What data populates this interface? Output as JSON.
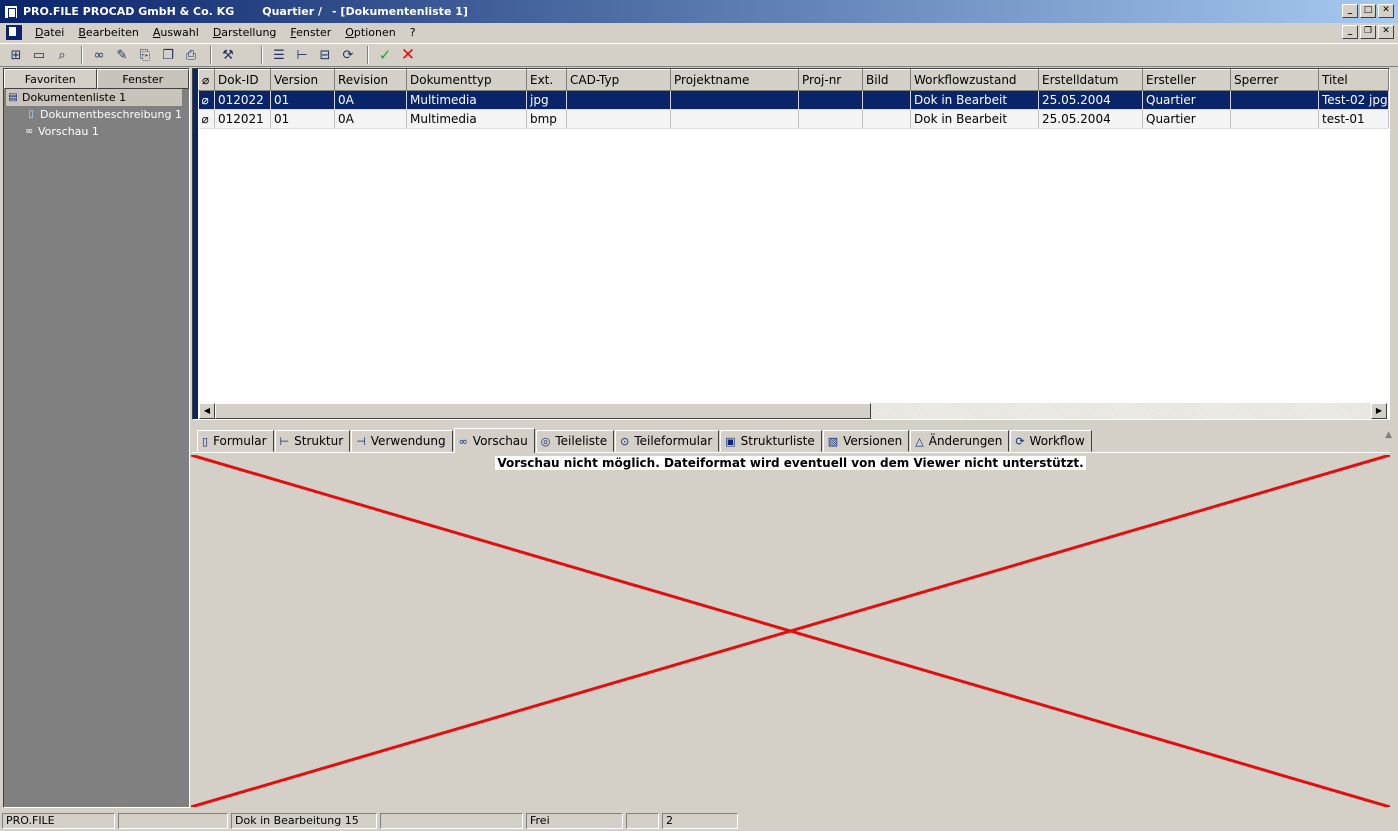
{
  "window": {
    "app_title": "PRO.FILE PROCAD GmbH & Co. KG",
    "user_context": "Quartier /",
    "doc_title": "- [Dokumentenliste 1]"
  },
  "menu": [
    "Datei",
    "Bearbeiten",
    "Auswahl",
    "Darstellung",
    "Fenster",
    "Optionen",
    "?"
  ],
  "toolbar": {
    "icons": [
      "new-structure-icon",
      "new-document-icon",
      "search-icon",
      "preview-glasses-icon",
      "edit-icon",
      "checkout-icon",
      "copy-icon",
      "print-icon",
      "tools-icon",
      "list-view-icon",
      "tree-view-icon",
      "structure-icon",
      "workflow-icon",
      "accept-check-icon",
      "cancel-x-icon"
    ],
    "accept_color": "#2aa02a",
    "cancel_color": "#e01010"
  },
  "left_tabs": [
    "Favoriten",
    "Fenster"
  ],
  "tree": [
    "Dokumentenliste 1",
    "Dokumentbeschreibung 1",
    "Vorschau 1"
  ],
  "grid": {
    "columns": [
      "Dok-ID",
      "Version",
      "Revision",
      "Dokumenttyp",
      "Ext.",
      "CAD-Typ",
      "Projektname",
      "Proj-nr",
      "Bild",
      "Workflowzustand",
      "Erstelldatum",
      "Ersteller",
      "Sperrer",
      "Titel"
    ],
    "rows": [
      [
        "012022",
        "01",
        "0A",
        "Multimedia",
        "jpg",
        "",
        "",
        "",
        "",
        "Dok in Bearbeit",
        "25.05.2004",
        "Quartier",
        "",
        "Test-02 jpg"
      ],
      [
        "012021",
        "01",
        "0A",
        "Multimedia",
        "bmp",
        "",
        "",
        "",
        "",
        "Dok in Bearbeit",
        "25.05.2004",
        "Quartier",
        "",
        "test-01"
      ]
    ],
    "selected_row": 0,
    "selection_color": "#0a246a"
  },
  "tabs": [
    "Formular",
    "Struktur",
    "Verwendung",
    "Vorschau",
    "Teileliste",
    "Teileformular",
    "Strukturliste",
    "Versionen",
    "Änderungen",
    "Workflow"
  ],
  "active_tab": "Vorschau",
  "preview": {
    "message": "Vorschau nicht möglich. Dateiformat wird eventuell von dem Viewer nicht unterstützt.",
    "cross_color": "#e01010"
  },
  "status": [
    "PRO.FILE",
    "",
    "Dok in Bearbeitung 15",
    "",
    "Frei",
    "",
    "2",
    ""
  ]
}
